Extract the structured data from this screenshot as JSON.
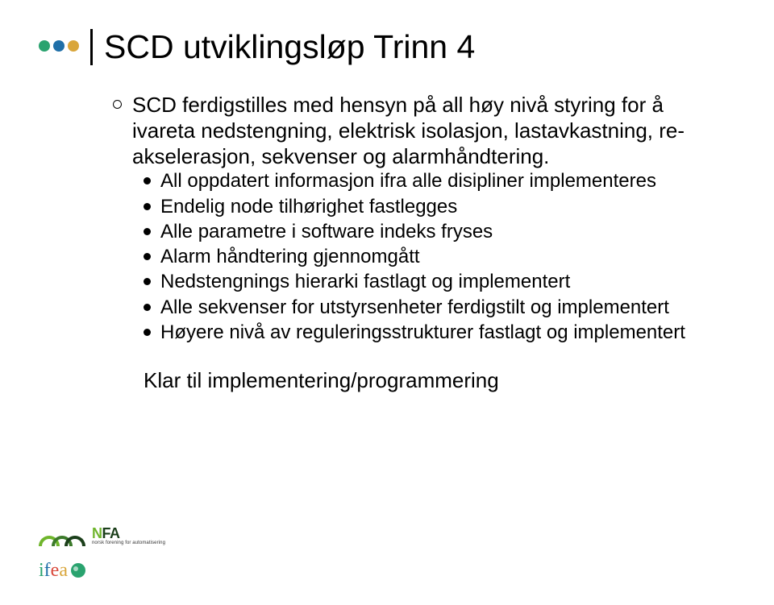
{
  "title": "SCD utviklingsløp Trinn 4",
  "decor_dots": [
    "#2aa36f",
    "#1f6fa8",
    "#d9a63b"
  ],
  "main_bullet": {
    "text": "SCD ferdigstilles med hensyn på all høy nivå styring for å ivareta nedstengning, elektrisk isolasjon, lastavkastning, re-akselerasjon, sekvenser og alarmhåndtering.",
    "sub": [
      "All oppdatert informasjon ifra alle disipliner implementeres",
      "Endelig node tilhørighet fastlegges",
      "Alle parametre i software indeks fryses",
      "Alarm håndtering gjennomgått",
      "Nedstengnings hierarki fastlagt og implementert",
      "Alle sekvenser for utstyrsenheter ferdigstilt og implementert",
      "Høyere nivå av reguleringsstrukturer fastlagt og implementert"
    ]
  },
  "final_line": "Klar til implementering/programmering",
  "logos": {
    "nfa_main": "NFA",
    "nfa_sub": "norsk forening for automatisering",
    "ifea": {
      "i": "i",
      "f": "f",
      "e": "e",
      "a": "a"
    }
  }
}
